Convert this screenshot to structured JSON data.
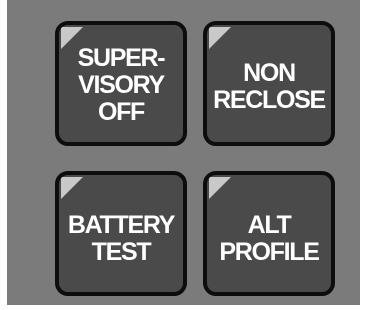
{
  "panel": {
    "buttons": [
      {
        "lines": [
          "SUPER-",
          "VISORY",
          "OFF"
        ]
      },
      {
        "lines": [
          "NON",
          "RECLOSE"
        ]
      },
      {
        "lines": [
          "BATTERY",
          "TEST"
        ]
      },
      {
        "lines": [
          "ALT",
          "PROFILE"
        ]
      }
    ]
  },
  "colors": {
    "panel_bg": "#7b7b7b",
    "button_face": "#4a4a4a",
    "button_border": "#0d0d0d",
    "corner_indicator": "#c9c9c9",
    "label_text": "#ffffff"
  },
  "icons": {
    "corner_indicator": "corner-indicator-icon"
  }
}
